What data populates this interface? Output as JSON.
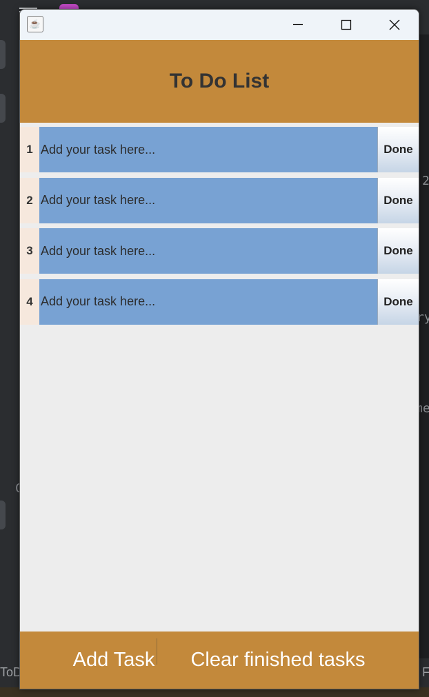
{
  "window": {
    "title_icon": "java-icon",
    "controls": {
      "minimize": "minimize-icon",
      "maximize": "maximize-icon",
      "close": "close-icon"
    }
  },
  "header": {
    "title": "To Do List"
  },
  "tasks": [
    {
      "number": "1",
      "placeholder": "Add your task here...",
      "value": "",
      "done_label": "Done"
    },
    {
      "number": "2",
      "placeholder": "Add your task here...",
      "value": "",
      "done_label": "Done"
    },
    {
      "number": "3",
      "placeholder": "Add your task here...",
      "value": "",
      "done_label": "Done"
    },
    {
      "number": "4",
      "placeholder": "Add your task here...",
      "value": "",
      "done_label": "Done"
    }
  ],
  "footer": {
    "add_label": "Add Task",
    "clear_label": "Clear finished tasks"
  },
  "background": {
    "status_left": "ToD",
    "status_right": "F",
    "fragments": [
      "2",
      "ry",
      "me",
      "C"
    ]
  },
  "colors": {
    "accent": "#c3893b",
    "task_field": "#78a2d3",
    "task_number_bg": "#f6e8dd",
    "window_bg": "#ededed"
  }
}
